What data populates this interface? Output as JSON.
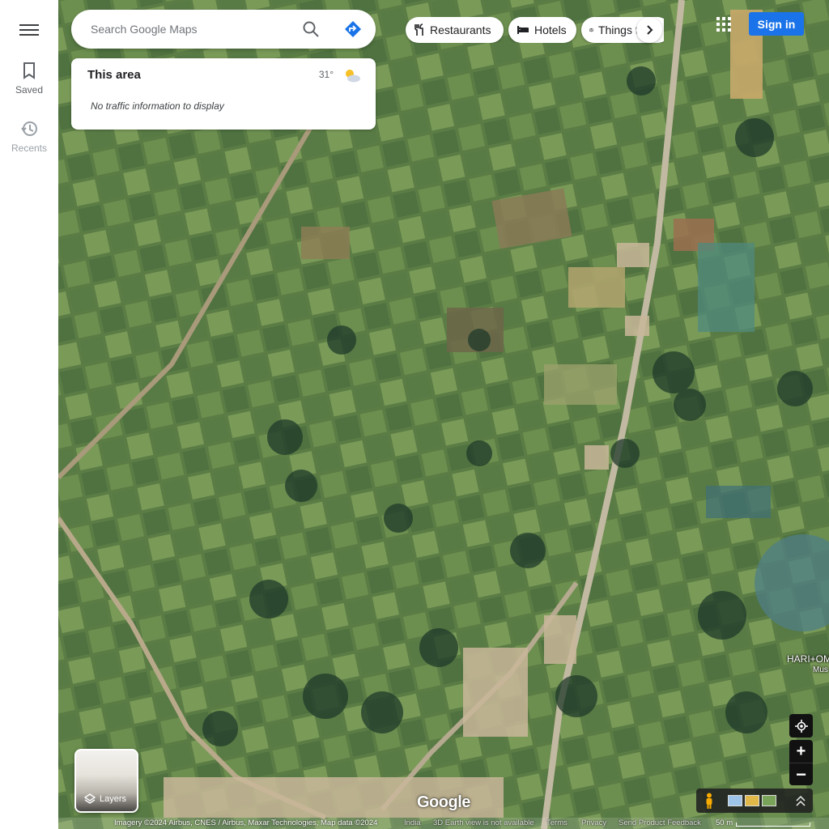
{
  "rail": {
    "saved_label": "Saved",
    "recents_label": "Recents"
  },
  "search": {
    "placeholder": "Search Google Maps"
  },
  "area_panel": {
    "title": "This area",
    "temperature": "31°",
    "weather_icon": "partly-cloudy-icon",
    "traffic_note": "No traffic information to display"
  },
  "chips": [
    {
      "label": "Restaurants",
      "icon": "fork-knife-icon"
    },
    {
      "label": "Hotels",
      "icon": "bed-icon"
    },
    {
      "label": "Things to do",
      "icon": "camera-icon"
    }
  ],
  "header": {
    "signin_label": "Sign in"
  },
  "layers": {
    "label": "Layers"
  },
  "map": {
    "logo": "Google",
    "place_label": "HARI+OM",
    "place_sublabel": "Mus"
  },
  "footer": {
    "imagery": "Imagery ©2024 Airbus, CNES / Airbus, Maxar Technologies, Map data ©2024",
    "country": "India",
    "earth_note": "3D Earth view is not available",
    "terms": "Terms",
    "privacy": "Privacy",
    "feedback": "Send Product Feedback",
    "scale": "50 m"
  },
  "colors": {
    "accent": "#1a73e8",
    "control_dark": "#111111"
  }
}
